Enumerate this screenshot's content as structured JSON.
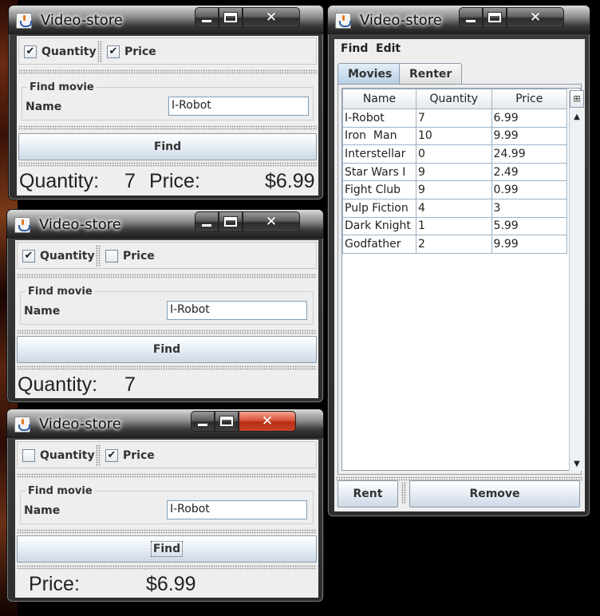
{
  "window_title": "Video-store",
  "windows": [
    {
      "quantity_checkbox": {
        "label": "Quantity",
        "checked": true,
        "mark": "✔"
      },
      "price_checkbox": {
        "label": "Price",
        "checked": true,
        "mark": "✔"
      },
      "find_group_title": "Find movie",
      "name_label": "Name",
      "name_value": "I-Robot",
      "find_button": "Find",
      "status": {
        "quantity_label": "Quantity:",
        "quantity_value": "7",
        "price_label": "Price:",
        "price_value": "$6.99"
      }
    },
    {
      "quantity_checkbox": {
        "label": "Quantity",
        "checked": true,
        "mark": "✔"
      },
      "price_checkbox": {
        "label": "Price",
        "checked": false,
        "mark": ""
      },
      "find_group_title": "Find movie",
      "name_label": "Name",
      "name_value": "I-Robot",
      "find_button": "Find",
      "status": {
        "quantity_label": "Quantity:",
        "quantity_value": "7"
      }
    },
    {
      "quantity_checkbox": {
        "label": "Quantity",
        "checked": false,
        "mark": ""
      },
      "price_checkbox": {
        "label": "Price",
        "checked": true,
        "mark": "✔"
      },
      "find_group_title": "Find movie",
      "name_label": "Name",
      "name_value": "I-Robot",
      "find_button": "Find",
      "status": {
        "price_label": "Price:",
        "price_value": "$6.99"
      }
    }
  ],
  "inventory_window": {
    "menu": [
      "Find",
      "Edit"
    ],
    "tabs": [
      "Movies",
      "Renter"
    ],
    "active_tab": "Movies",
    "columns": [
      "Name",
      "Quantity",
      "Price"
    ],
    "rows": [
      [
        "I-Robot",
        "7",
        "6.99"
      ],
      [
        "Iron  Man",
        "10",
        "9.99"
      ],
      [
        "Interstellar",
        "0",
        "24.99"
      ],
      [
        "Star Wars I",
        "9",
        "2.49"
      ],
      [
        "Fight Club",
        "9",
        "0.99"
      ],
      [
        "Pulp Fiction",
        "4",
        "3"
      ],
      [
        "Dark Knight",
        "1",
        "5.99"
      ],
      [
        "Godfather",
        "2",
        "9.99"
      ]
    ],
    "rent_button": "Rent",
    "remove_button": "Remove"
  },
  "icons": {
    "app": "java-coffee-icon",
    "minimize": "minimize-icon",
    "maximize": "maximize-icon",
    "close": "close-icon",
    "scroll_up": "▲",
    "scroll_down": "▼",
    "column_control": "⊞"
  },
  "colors": {
    "close_hover": "#c9442a",
    "button_top": "#ffffff",
    "button_bottom": "#cdd9e6",
    "table_grid": "#9ab2c8"
  }
}
